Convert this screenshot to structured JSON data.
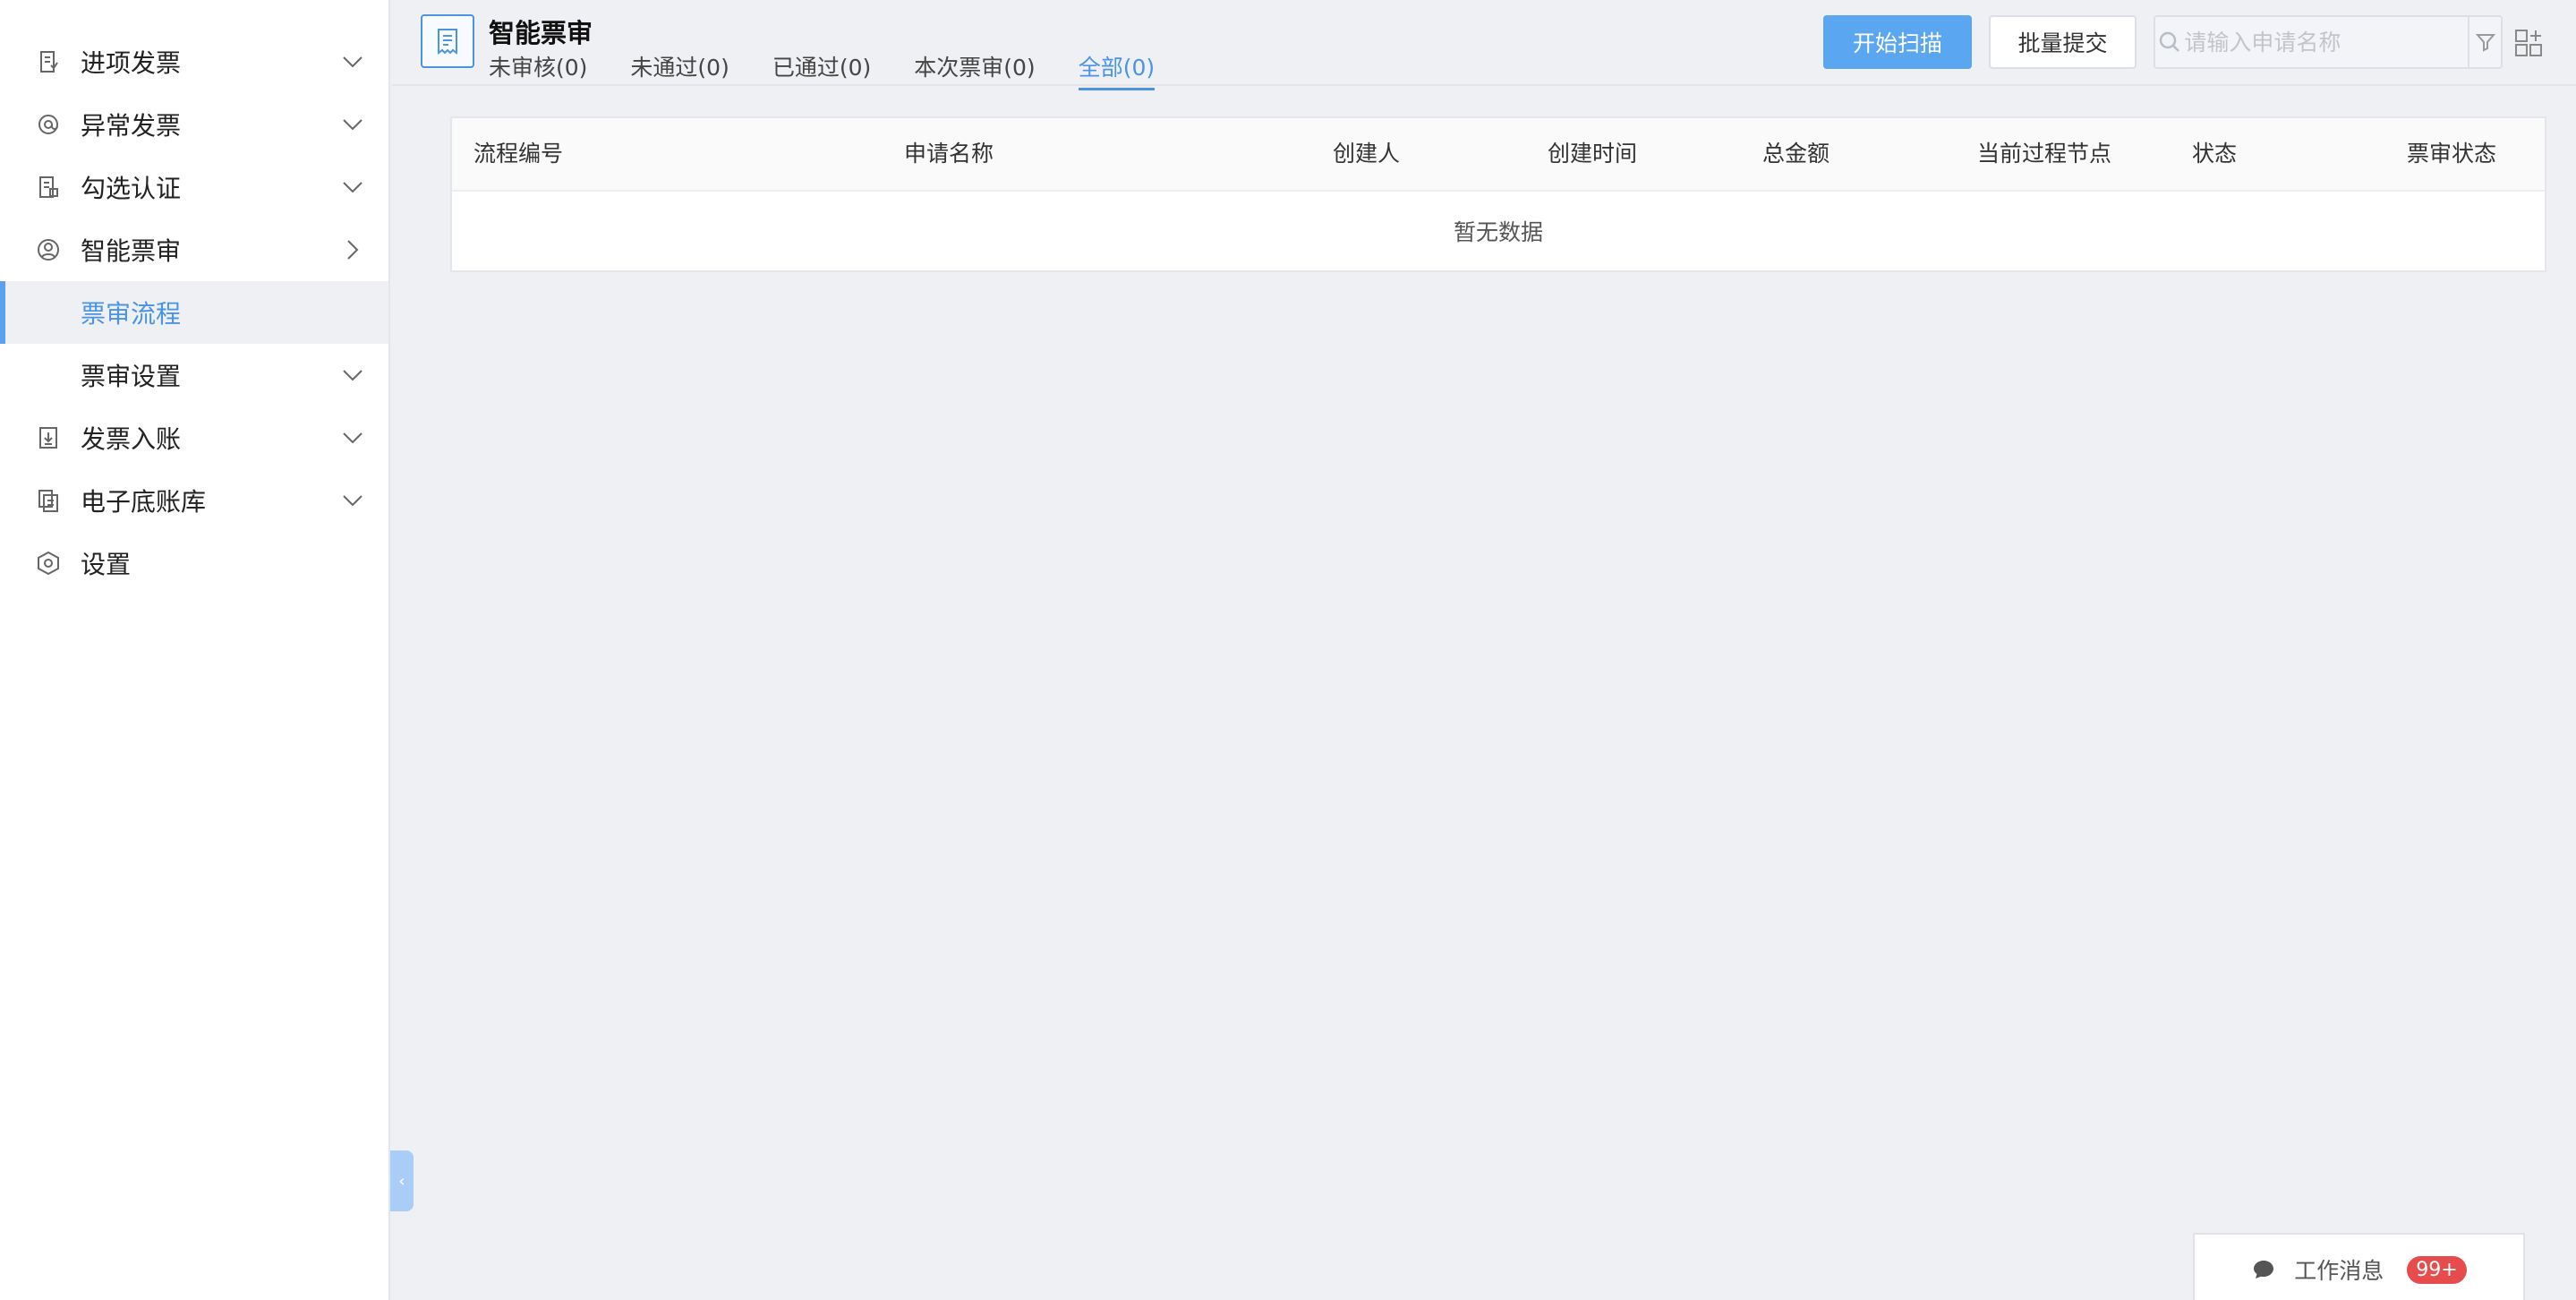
{
  "sidebar": {
    "items": [
      {
        "label": "进项发票",
        "icon": "invoice-icon",
        "arrow": "chevron-down-icon"
      },
      {
        "label": "异常发票",
        "icon": "at-icon",
        "arrow": "chevron-down-icon"
      },
      {
        "label": "勾选认证",
        "icon": "check-doc-icon",
        "arrow": "chevron-down-icon"
      },
      {
        "label": "智能票审",
        "icon": "user-circle-icon",
        "arrow": "chevron-right-icon"
      },
      {
        "label": "票审流程",
        "active": true
      },
      {
        "label": "票审设置",
        "arrow": "chevron-down-icon"
      },
      {
        "label": "发票入账",
        "icon": "download-doc-icon",
        "arrow": "chevron-down-icon"
      },
      {
        "label": "电子底账库",
        "icon": "copy-doc-icon",
        "arrow": "chevron-down-icon"
      },
      {
        "label": "设置",
        "icon": "hexagon-settings-icon"
      }
    ],
    "collapse_icon": "chevron-left-icon"
  },
  "header": {
    "title": "智能票审",
    "page_icon": "receipt-icon",
    "tabs": [
      {
        "label": "未审核(0)"
      },
      {
        "label": "未通过(0)"
      },
      {
        "label": "已通过(0)"
      },
      {
        "label": "本次票审(0)"
      },
      {
        "label": "全部(0)",
        "active": true
      }
    ],
    "scan_button": "开始扫描",
    "batch_submit_button": "批量提交",
    "search": {
      "placeholder": "请输入申请名称",
      "value": ""
    }
  },
  "table": {
    "columns": [
      "流程编号",
      "申请名称",
      "创建人",
      "创建时间",
      "总金额",
      "当前过程节点",
      "状态",
      "票审状态"
    ],
    "rows": [],
    "empty_text": "暂无数据"
  },
  "work_message": {
    "label": "工作消息",
    "badge": "99+"
  },
  "colors": {
    "accent": "#4b93e3",
    "primary_button": "#5aa6f0",
    "badge": "#e74c4c",
    "background": "#eff0f4"
  }
}
